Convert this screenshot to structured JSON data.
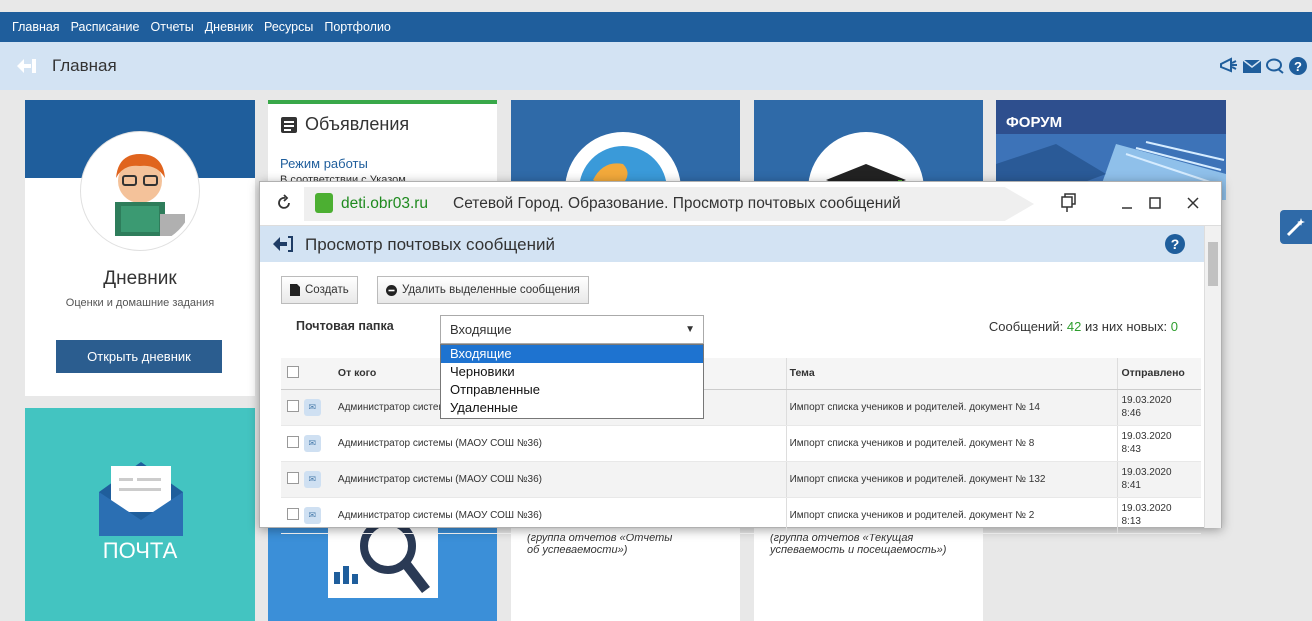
{
  "topnav": {
    "items": [
      "Главная",
      "Расписание",
      "Отчеты",
      "Дневник",
      "Ресурсы",
      "Портфолио"
    ]
  },
  "breadcrumb": {
    "title": "Главная"
  },
  "header_icons": [
    "megaphone-icon",
    "mail-icon",
    "chat-icon",
    "help-icon"
  ],
  "diary": {
    "title": "Дневник",
    "subtitle": "Оценки и домашние задания",
    "button": "Открыть дневник"
  },
  "mail_tile": {
    "label": "ПОЧТА"
  },
  "news": {
    "title": "Объявления",
    "item_title": "Режим работы",
    "item_text": "В соответствии с Указом"
  },
  "forum": {
    "label": "ФОРУМ"
  },
  "reports": {
    "report1": "(группа отчетов «Отчеты об успеваемости»)",
    "report2": "(группа отчетов «Текущая успеваемость и посещаемость»)"
  },
  "popup": {
    "url": "deti.obr03.ru",
    "window_title": "Сетевой Город. Образование. Просмотр почтовых сообщений",
    "header": "Просмотр почтовых сообщений",
    "create_button": "Создать",
    "delete_button": "Удалить выделенные сообщения",
    "folder_label": "Почтовая папка",
    "folder_selected": "Входящие",
    "folder_options": [
      "Входящие",
      "Черновики",
      "Отправленные",
      "Удаленные"
    ],
    "count_label": "Сообщений:",
    "count_total": "42",
    "count_new_label": "из них новых:",
    "count_new": "0",
    "columns": {
      "from": "От кого",
      "subject": "Тема",
      "sent": "Отправлено"
    },
    "rows": [
      {
        "from": "Администратор системы (МАОУ СОШ №36)",
        "subject": "Импорт списка учеников и родителей. документ № 14",
        "date": "19.03.2020",
        "time": "8:46"
      },
      {
        "from": "Администратор системы (МАОУ СОШ №36)",
        "subject": "Импорт списка учеников и родителей. документ № 8",
        "date": "19.03.2020",
        "time": "8:43"
      },
      {
        "from": "Администратор системы (МАОУ СОШ №36)",
        "subject": "Импорт списка учеников и родителей. документ № 132",
        "date": "19.03.2020",
        "time": "8:41"
      },
      {
        "from": "Администратор системы (МАОУ СОШ №36)",
        "subject": "Импорт списка учеников и родителей. документ № 2",
        "date": "19.03.2020",
        "time": "8:13"
      }
    ]
  },
  "colors": {
    "nav": "#1f5e9c",
    "crumb": "#d3e3f3",
    "teal": "#43c4c1",
    "link": "#1f5e9c",
    "green": "#2e9e2e"
  }
}
